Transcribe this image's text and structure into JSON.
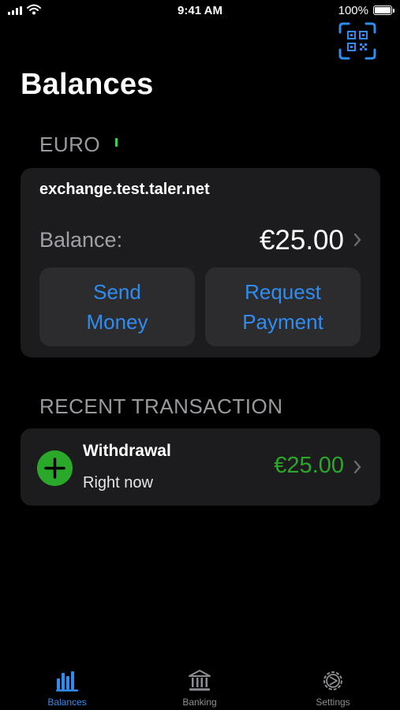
{
  "status_bar": {
    "time": "9:41 AM",
    "battery_percent": "100%",
    "battery_level": 1.0
  },
  "header": {
    "title": "Balances",
    "qr_icon": "qr-scan-icon"
  },
  "currency_section": {
    "header": "EURO",
    "exchange": "exchange.test.taler.net",
    "balance_label": "Balance:",
    "balance_amount": "€25.00",
    "send_button": {
      "line1": "Send",
      "line2": "Money"
    },
    "request_button": {
      "line1": "Request",
      "line2": "Payment"
    }
  },
  "recent_section": {
    "header": "RECENT TRANSACTION",
    "transaction": {
      "icon": "plus-circle-icon",
      "title": "Withdrawal",
      "time": "Right now",
      "amount": "€25.00"
    }
  },
  "tab_bar": {
    "active_index": 0,
    "tabs": [
      {
        "label": "Balances",
        "icon": "bar-chart-icon"
      },
      {
        "label": "Banking",
        "icon": "bank-icon"
      },
      {
        "label": "Settings",
        "icon": "gear-icon"
      }
    ]
  },
  "colors": {
    "accent": "#2f8df2",
    "positive": "#2aa82a",
    "card": "#1c1c1e",
    "button": "#2c2c2e"
  }
}
